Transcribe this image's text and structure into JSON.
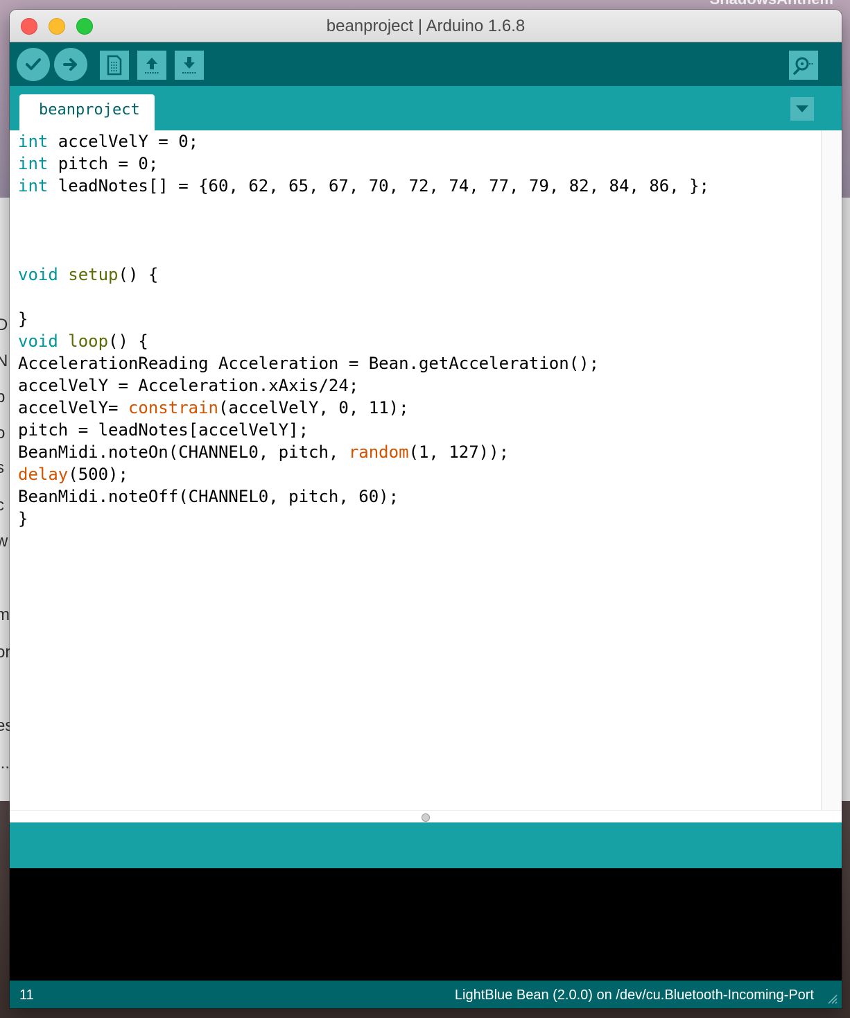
{
  "desktop": {
    "corner_text": "ShadowsAnthem",
    "behind_window_letters": [
      "D",
      "N",
      "p",
      "o",
      "s",
      "c",
      "w",
      "m",
      "or",
      "es",
      "..."
    ]
  },
  "window": {
    "title": "beanproject | Arduino 1.6.8"
  },
  "toolbar": {
    "buttons": [
      {
        "name": "verify",
        "icon": "checkmark-icon"
      },
      {
        "name": "upload",
        "icon": "arrow-right-icon"
      },
      {
        "name": "new",
        "icon": "new-document-icon"
      },
      {
        "name": "open",
        "icon": "arrow-up-icon"
      },
      {
        "name": "save",
        "icon": "arrow-down-icon"
      }
    ],
    "serial_monitor_icon": "magnifier-icon"
  },
  "tabs": [
    {
      "label": "beanproject",
      "active": true
    }
  ],
  "editor": {
    "lines": [
      [
        {
          "t": "int",
          "c": "kw"
        },
        {
          "t": " accelVelY = 0;",
          "c": ""
        }
      ],
      [
        {
          "t": "int",
          "c": "kw"
        },
        {
          "t": " pitch = 0;",
          "c": ""
        }
      ],
      [
        {
          "t": "int",
          "c": "kw"
        },
        {
          "t": " leadNotes[] = {60, 62, 65, 67, 70, 72, 74, 77, 79, 82, 84, 86, };",
          "c": ""
        }
      ],
      [],
      [],
      [],
      [
        {
          "t": "void",
          "c": "kw"
        },
        {
          "t": " ",
          "c": ""
        },
        {
          "t": "setup",
          "c": "fn"
        },
        {
          "t": "() {",
          "c": ""
        }
      ],
      [],
      [
        {
          "t": "}",
          "c": ""
        }
      ],
      [
        {
          "t": "void",
          "c": "kw"
        },
        {
          "t": " ",
          "c": ""
        },
        {
          "t": "loop",
          "c": "fn"
        },
        {
          "t": "() {",
          "c": ""
        }
      ],
      [
        {
          "t": "AccelerationReading Acceleration = Bean.getAcceleration();",
          "c": ""
        }
      ],
      [
        {
          "t": "accelVelY = Acceleration.xAxis/24;",
          "c": ""
        }
      ],
      [
        {
          "t": "accelVelY= ",
          "c": ""
        },
        {
          "t": "constrain",
          "c": "lib"
        },
        {
          "t": "(accelVelY, 0, 11);",
          "c": ""
        }
      ],
      [
        {
          "t": "pitch = leadNotes[accelVelY];",
          "c": ""
        }
      ],
      [
        {
          "t": "BeanMidi.noteOn(CHANNEL0, pitch, ",
          "c": ""
        },
        {
          "t": "random",
          "c": "lib"
        },
        {
          "t": "(1, 127));",
          "c": ""
        }
      ],
      [
        {
          "t": "delay",
          "c": "lib"
        },
        {
          "t": "(500);",
          "c": ""
        }
      ],
      [
        {
          "t": "BeanMidi.noteOff(CHANNEL0, pitch, 60);",
          "c": ""
        }
      ],
      [
        {
          "t": "}",
          "c": ""
        }
      ]
    ]
  },
  "status": {
    "line_number": "11",
    "board_port": "LightBlue Bean (2.0.0) on /dev/cu.Bluetooth-Incoming-Port"
  },
  "colors": {
    "toolbar_bg": "#006468",
    "tabbar_bg": "#17a1a5",
    "button_bg": "#4db7bb",
    "keyword": "#00979c",
    "function": "#5e6d03",
    "library_function": "#d35400"
  }
}
